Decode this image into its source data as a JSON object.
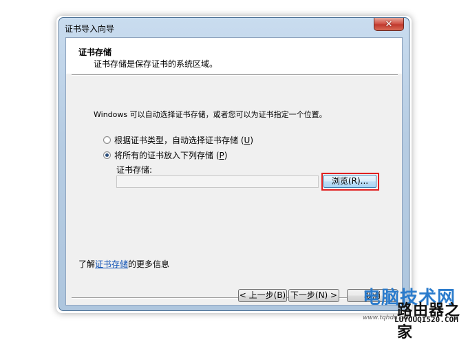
{
  "window": {
    "title": "证书导入向导",
    "close_symbol": "✕"
  },
  "header": {
    "title": "证书存储",
    "subtitle": "证书存储是保存证书的系统区域。"
  },
  "main": {
    "description": "Windows 可以自动选择证书存储，或者您可以为证书指定一个位置。",
    "options": [
      {
        "label": "根据证书类型，自动选择证书存储",
        "accel": "U",
        "checked": false
      },
      {
        "label": "将所有的证书放入下列存储",
        "accel": "P",
        "checked": true
      }
    ],
    "store_label": "证书存储:",
    "store_value": "",
    "browse_label": "浏览(R)...",
    "info_prefix": "了解",
    "info_link": "证书存储",
    "info_suffix": "的更多信息"
  },
  "buttons": {
    "back": "< 上一步(B)",
    "next": "下一步(N) >",
    "cancel": "取消"
  },
  "watermark": {
    "line1": "电脑技术网",
    "line2": "路由器之家",
    "url": "LUYOUQI520.COM",
    "url2": "www.tqhdn.com"
  },
  "colors": {
    "highlight": "#e02020",
    "link": "#0c50b4",
    "title_bar": "#b7cde3"
  }
}
